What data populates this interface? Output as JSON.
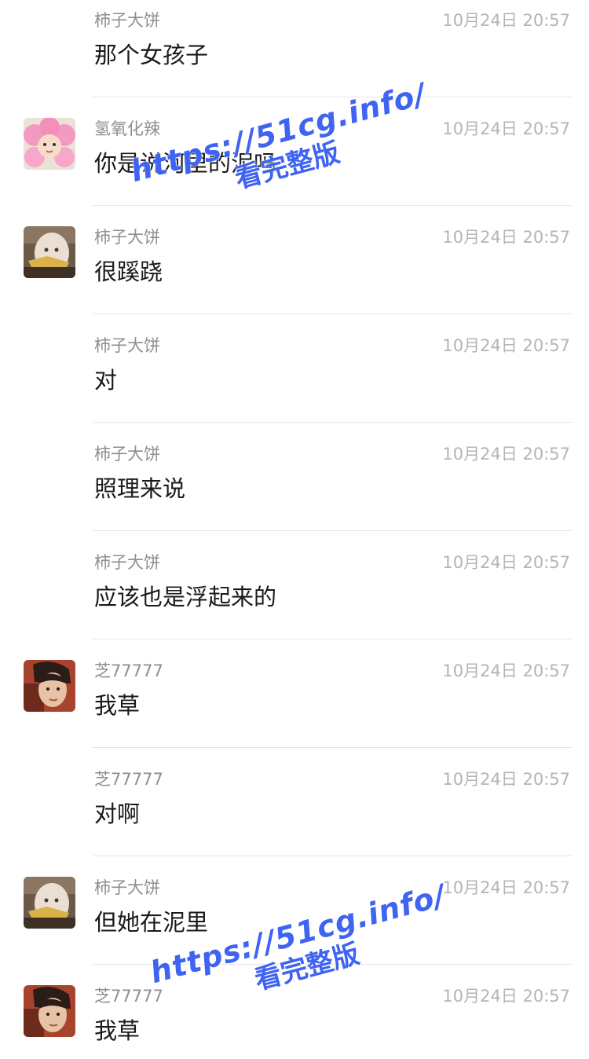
{
  "messages": [
    {
      "sender": "柿子大饼",
      "time": "10月24日 20:57",
      "text": "那个女孩子",
      "avatar": "none"
    },
    {
      "sender": "氢氧化辣",
      "time": "10月24日 20:57",
      "text": "你是说河里的泥吗",
      "avatar": "pink-flower"
    },
    {
      "sender": "柿子大饼",
      "time": "10月24日 20:57",
      "text": "很蹊跷",
      "avatar": "masked-face"
    },
    {
      "sender": "柿子大饼",
      "time": "10月24日 20:57",
      "text": "对",
      "avatar": "none"
    },
    {
      "sender": "柿子大饼",
      "time": "10月24日 20:57",
      "text": "照理来说",
      "avatar": "none"
    },
    {
      "sender": "柿子大饼",
      "time": "10月24日 20:57",
      "text": "应该也是浮起来的",
      "avatar": "none"
    },
    {
      "sender": "芝77777",
      "time": "10月24日 20:57",
      "text": "我草",
      "avatar": "photo-face"
    },
    {
      "sender": "芝77777",
      "time": "10月24日 20:57",
      "text": "对啊",
      "avatar": "none"
    },
    {
      "sender": "柿子大饼",
      "time": "10月24日 20:57",
      "text": "但她在泥里",
      "avatar": "masked-face"
    },
    {
      "sender": "芝77777",
      "time": "10月24日 20:57",
      "text": "我草",
      "avatar": "photo-face"
    }
  ],
  "watermarks": [
    {
      "url": "https://51cg.info/",
      "caption": "看完整版"
    },
    {
      "url": "https://51cg.info/",
      "caption": "看完整版"
    }
  ],
  "colors": {
    "sender": "#8e8e93",
    "time": "#b4b4b9",
    "text": "#1a1a1a",
    "divider": "#e6e6e6",
    "watermark": "#3f63f2"
  }
}
